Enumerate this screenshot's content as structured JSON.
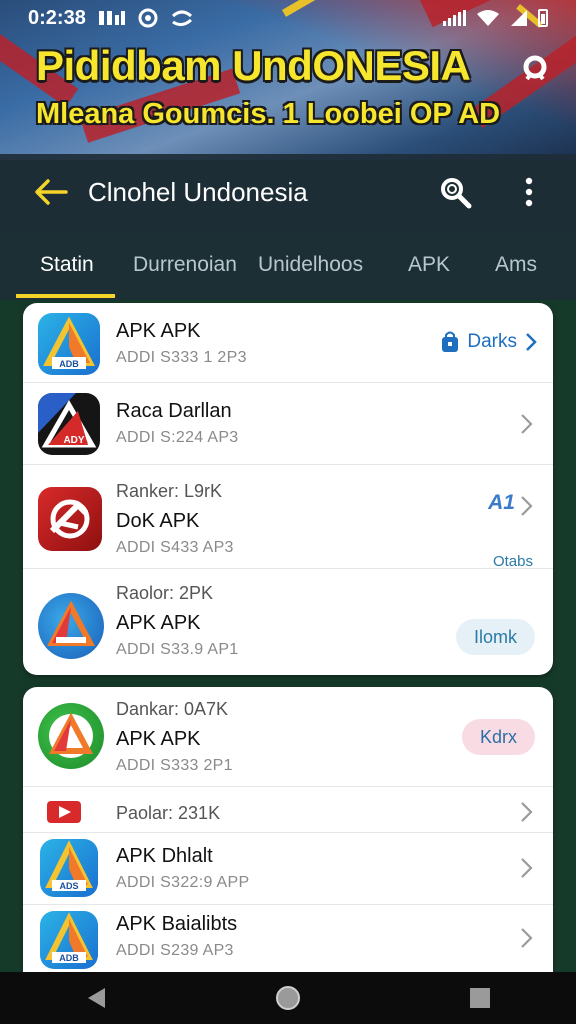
{
  "status_bar": {
    "time": "0:2:38",
    "left_icons": [
      "sim-icon",
      "circle-p-icon",
      "sync-icon"
    ],
    "right_icons": [
      "signal-icon",
      "wifi-icon",
      "cell-icon",
      "battery-icon"
    ]
  },
  "banner": {
    "title": "Pididbam UndONESIA",
    "subtitle": "Mleana Goumcis. 1 Loobei OP AD"
  },
  "app_bar": {
    "title": "Clnohel Undonesia",
    "back_icon": "arrow-left-icon",
    "search_icon": "search-icon",
    "more_icon": "more-vert-icon"
  },
  "tabs": [
    {
      "label": "Statin",
      "active": true
    },
    {
      "label": "Durrenoian",
      "active": false
    },
    {
      "label": "Unidelhoos",
      "active": false
    },
    {
      "label": "APK",
      "active": false
    },
    {
      "label": "Ams",
      "active": false
    }
  ],
  "list_top": [
    {
      "meta": "",
      "name": "APK APK",
      "sub": "ADDI S333 1 2P3",
      "icon_label": "ADB",
      "action_type": "link",
      "action_label": "Darks",
      "action_icon": "bag-icon"
    },
    {
      "meta": "",
      "name": "Raca Darllan",
      "sub": "ADDI S:224 AP3",
      "icon_label": "ADY",
      "action_type": "chevron"
    },
    {
      "meta": "Ranker: L9rK",
      "name": "DoK APK",
      "sub": "ADDI S433 AP3",
      "icon_label": "",
      "action_type": "chevron",
      "action_icon_text": "A1",
      "extra_tag": "Otabs"
    },
    {
      "meta": "Raolor: 2PK",
      "name": "APK APK",
      "sub": "ADDI S33.9 AP1",
      "icon_label": "",
      "action_type": "pill",
      "action_label": "Ilomk"
    }
  ],
  "list_bottom": [
    {
      "meta": "Dankar: 0A7K",
      "name": "APK APK",
      "sub": "ADDI S333 2P1",
      "icon_label": "",
      "action_type": "pill-pink",
      "action_label": "Kdrx"
    },
    {
      "meta": "Paolar: 231K",
      "name": "",
      "sub": "",
      "icon_label": "",
      "action_type": "chevron"
    },
    {
      "meta": "",
      "name": "APK Dhlalt",
      "sub": "ADDI S322:9 APP",
      "icon_label": "ADS",
      "action_type": "chevron"
    },
    {
      "meta": "",
      "name": "APK Baialibts",
      "sub": "ADDI S239 AP3",
      "icon_label": "ADB",
      "action_type": "chevron"
    }
  ],
  "colors": {
    "accent_yellow": "#f5d42a",
    "banner_text": "#f6e62d",
    "link_blue": "#1e6fbf",
    "background_green": "#163a2a"
  },
  "nav_bar": [
    "back-triangle-icon",
    "home-circle-icon",
    "recents-square-icon"
  ]
}
